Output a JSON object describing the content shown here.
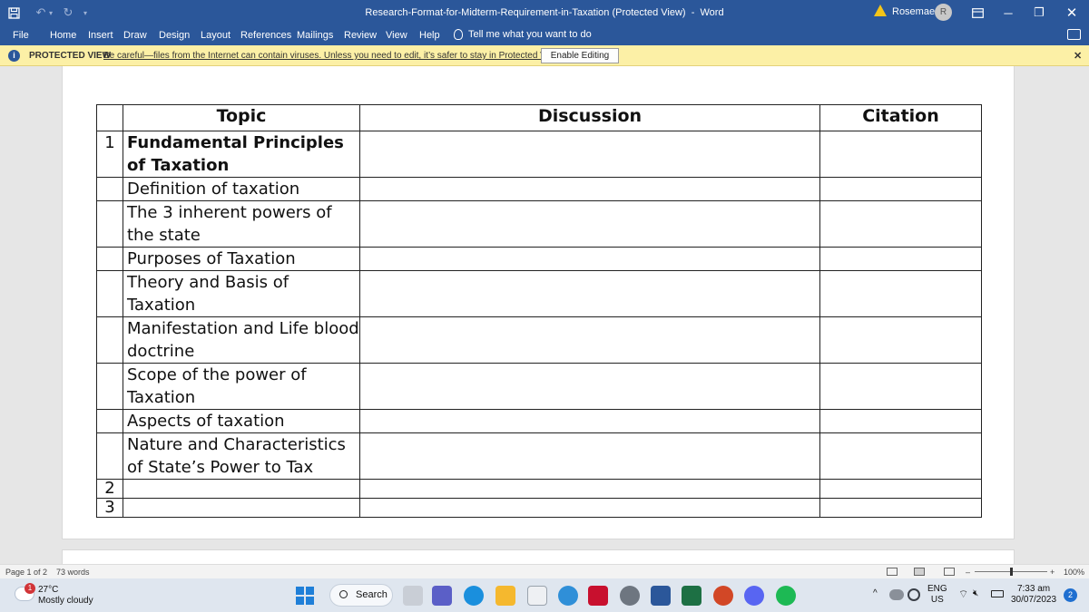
{
  "window": {
    "title": "Research-Format-for-Midterm-Requirement-in-Taxation (Protected View)",
    "title_sep": "-",
    "app": "Word",
    "user": "Rosemae",
    "avatar_initial": "R"
  },
  "ribbon": {
    "tabs": [
      "File",
      "Home",
      "Insert",
      "Draw",
      "Design",
      "Layout",
      "References",
      "Mailings",
      "Review",
      "View",
      "Help"
    ],
    "tell_me": "Tell me what you want to do"
  },
  "protected_view": {
    "label": "PROTECTED VIEW",
    "message": "Be careful—files from the Internet can contain viruses. Unless you need to edit, it’s safer to stay in Protected View.",
    "button": "Enable Editing"
  },
  "document": {
    "headers": {
      "num": "",
      "topic": "Topic",
      "discussion": "Discussion",
      "citation": "Citation"
    },
    "rows": [
      {
        "num": "1",
        "topic": "Fundamental Principles of Taxation",
        "bold": true,
        "discussion": "",
        "citation": ""
      },
      {
        "num": "",
        "topic": "Definition of taxation",
        "bold": false,
        "discussion": "",
        "citation": ""
      },
      {
        "num": "",
        "topic": "The 3 inherent powers of the state",
        "bold": false,
        "discussion": "",
        "citation": ""
      },
      {
        "num": "",
        "topic": "Purposes of Taxation",
        "bold": false,
        "discussion": "",
        "citation": ""
      },
      {
        "num": "",
        "topic": "Theory and Basis of Taxation",
        "bold": false,
        "discussion": "",
        "citation": ""
      },
      {
        "num": "",
        "topic": "Manifestation and Life blood doctrine",
        "bold": false,
        "discussion": "",
        "citation": ""
      },
      {
        "num": "",
        "topic": "Scope of the power of Taxation",
        "bold": false,
        "discussion": "",
        "citation": ""
      },
      {
        "num": "",
        "topic": "Aspects of taxation",
        "bold": false,
        "discussion": "",
        "citation": ""
      },
      {
        "num": "",
        "topic": "Nature and Characteristics of State’s Power to Tax",
        "bold": false,
        "discussion": "",
        "citation": ""
      },
      {
        "num": "2",
        "topic": "",
        "bold": false,
        "discussion": "",
        "citation": ""
      },
      {
        "num": "3",
        "topic": "",
        "bold": false,
        "discussion": "",
        "citation": ""
      }
    ]
  },
  "status_bar": {
    "page": "Page 1 of 2",
    "words": "73 words",
    "zoom": "100%",
    "zoom_minus": "–",
    "zoom_plus": "+"
  },
  "taskbar": {
    "weather_temp": "27°C",
    "weather_desc": "Mostly cloudy",
    "weather_badge": "1",
    "search": "Search",
    "lang": "ENG",
    "region": "US",
    "time": "7:33 am",
    "date": "30/07/2023",
    "notifications": "2"
  }
}
